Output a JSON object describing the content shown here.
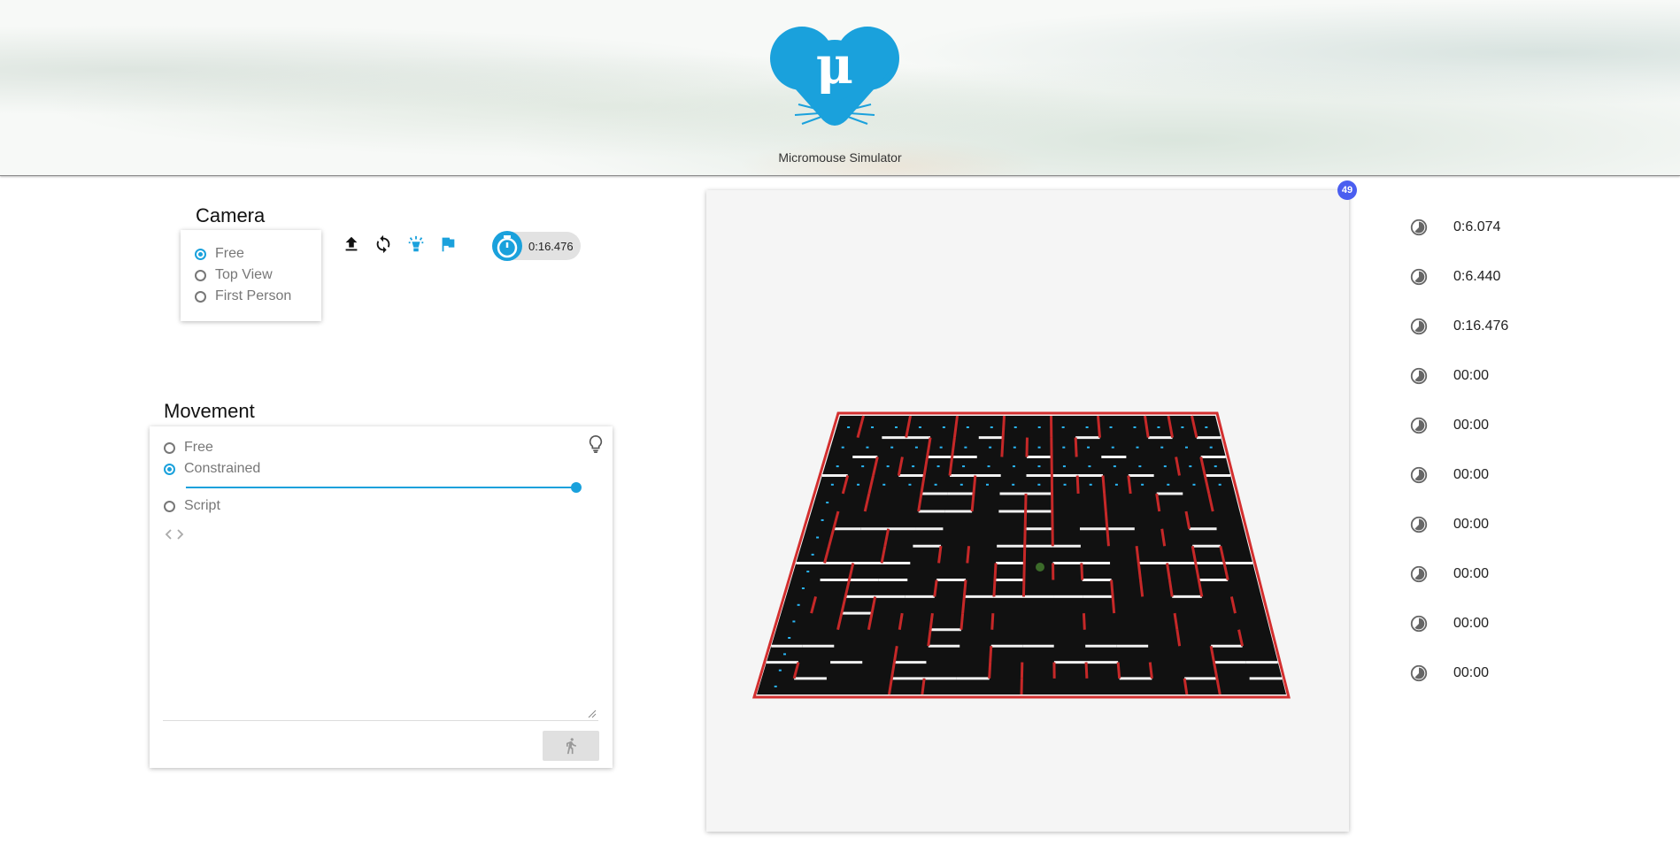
{
  "header": {
    "app_title": "Micromouse Simulator",
    "logo_glyph": "μ",
    "brand_color": "#1aa1dc"
  },
  "camera": {
    "title": "Camera",
    "options": [
      {
        "label": "Free",
        "selected": true
      },
      {
        "label": "Top View",
        "selected": false
      },
      {
        "label": "First Person",
        "selected": false
      }
    ]
  },
  "toolbar": {
    "icons": [
      "upload-icon",
      "refresh-icon",
      "lightbulb-icon",
      "flag-icon"
    ],
    "timer": "0:16.476"
  },
  "movement": {
    "title": "Movement",
    "options": [
      {
        "label": "Free",
        "selected": false
      },
      {
        "label": "Constrained",
        "selected": true
      },
      {
        "label": "Script",
        "selected": false
      }
    ],
    "speed_fraction": 1.0
  },
  "viewport": {
    "badge": "49"
  },
  "times": [
    "0:6.074",
    "0:6.440",
    "0:16.476",
    "00:00",
    "00:00",
    "00:00",
    "00:00",
    "00:00",
    "00:00",
    "00:00"
  ]
}
